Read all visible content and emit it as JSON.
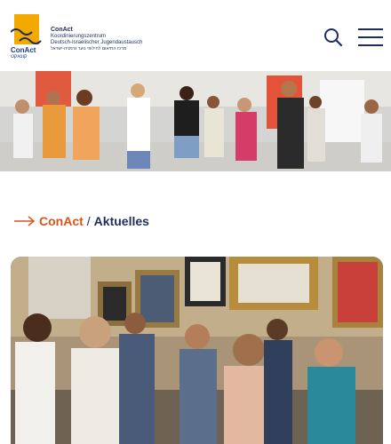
{
  "header": {
    "logo": {
      "wordmark": "ConAct",
      "hebrew": "קונאקט",
      "title": "ConAct",
      "subtitle": "Koordinierungszentrum",
      "subtitle2": "Deutsch-Israelischer Jugendaustausch",
      "hebrew_line": "מרכז התיאום לחילופי נוער גרמניה-ישראל"
    },
    "search_icon": "search-icon",
    "menu_icon": "hamburger-menu-icon"
  },
  "hero": {
    "alt": "Group of young people in a seminar room doing an activity"
  },
  "breadcrumb": {
    "home_label": "ConAct",
    "separator": "/",
    "current_label": "Aktuelles"
  },
  "article": {
    "image_alt": "Group of adults laughing and clapping in a room with framed pictures"
  },
  "colors": {
    "brand_orange": "#d9541e",
    "brand_navy": "#1f2d5c",
    "logo_yellow": "#f2a900"
  }
}
